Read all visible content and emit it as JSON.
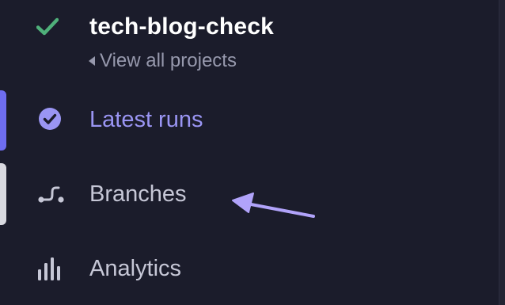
{
  "project": {
    "name": "tech-blog-check",
    "status_icon": "check-icon",
    "status_color": "#4fb07a",
    "back_link_label": "View all projects"
  },
  "nav": {
    "items": [
      {
        "label": "Latest runs",
        "icon": "check-circle-icon",
        "active": true,
        "color": "#9a95f3"
      },
      {
        "label": "Branches",
        "icon": "branch-icon",
        "active": false,
        "color": "#c6c7d6"
      },
      {
        "label": "Analytics",
        "icon": "bar-chart-icon",
        "active": false,
        "color": "#c6c7d6"
      }
    ]
  },
  "colors": {
    "background": "#1b1c2b",
    "accent": "#6e6df0",
    "hover_indicator": "#d9d9e0",
    "annotation_arrow": "#b1a3fa"
  },
  "annotation": {
    "type": "arrow",
    "points_to": "Branches"
  }
}
